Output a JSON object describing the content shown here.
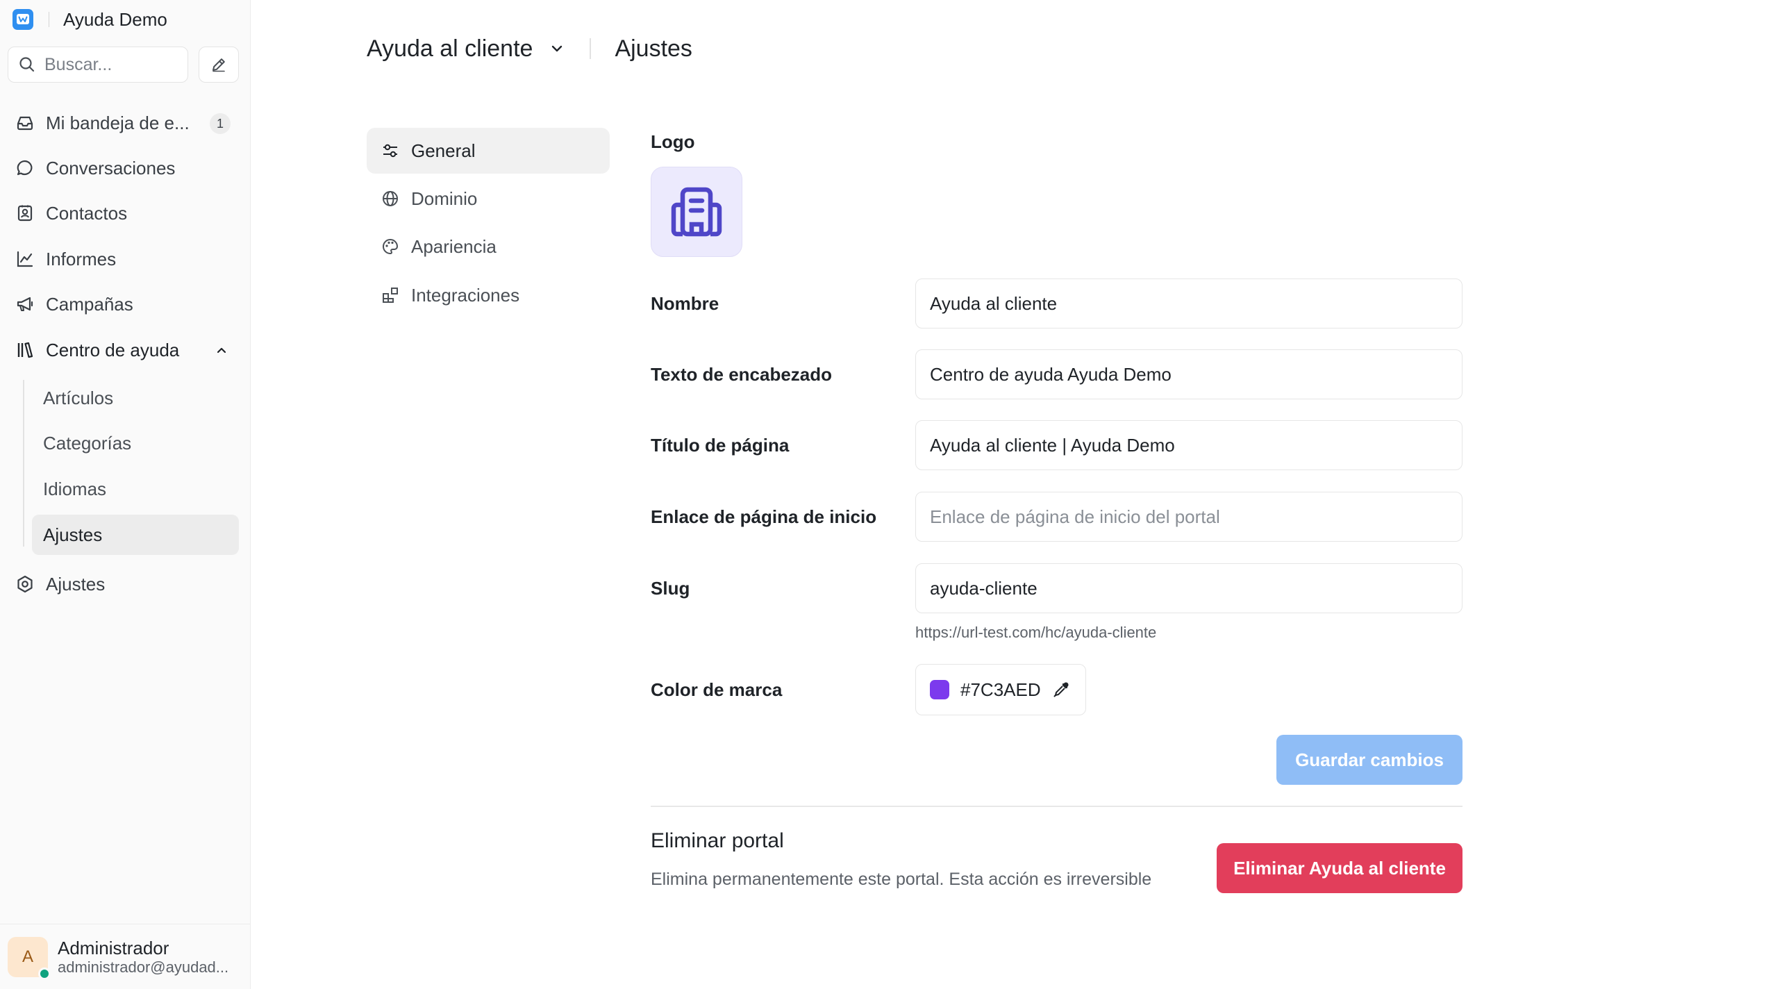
{
  "sidebar": {
    "brand": "Ayuda Demo",
    "search_placeholder": "Buscar...",
    "items": [
      {
        "label": "Mi bandeja de e...",
        "badge": "1",
        "icon": "inbox-icon"
      },
      {
        "label": "Conversaciones",
        "icon": "chat-bubble-icon"
      },
      {
        "label": "Contactos",
        "icon": "contact-card-icon"
      },
      {
        "label": "Informes",
        "icon": "line-chart-icon"
      },
      {
        "label": "Campañas",
        "icon": "megaphone-icon"
      },
      {
        "label": "Centro de ayuda",
        "icon": "library-books-icon",
        "expanded": true
      },
      {
        "label": "Ajustes",
        "icon": "settings-icon"
      }
    ],
    "help_center_subitems": [
      {
        "label": "Artículos"
      },
      {
        "label": "Categorías"
      },
      {
        "label": "Idiomas"
      },
      {
        "label": "Ajustes",
        "active": true
      }
    ],
    "profile": {
      "initial": "A",
      "name": "Administrador",
      "email": "administrador@ayudad...",
      "status_color": "#10a37f"
    }
  },
  "header": {
    "portal": "Ayuda al cliente",
    "page": "Ajustes"
  },
  "subnav": [
    {
      "label": "General",
      "icon": "sliders-icon",
      "active": true
    },
    {
      "label": "Dominio",
      "icon": "globe-icon"
    },
    {
      "label": "Apariencia",
      "icon": "palette-icon"
    },
    {
      "label": "Integraciones",
      "icon": "blocks-icon"
    }
  ],
  "form": {
    "logo_label": "Logo",
    "logo_icon": "building-icon",
    "name_label": "Nombre",
    "name_value": "Ayuda al cliente",
    "header_text_label": "Texto de encabezado",
    "header_text_value": "Centro de ayuda Ayuda Demo",
    "page_title_label": "Título de página",
    "page_title_value": "Ayuda al cliente | Ayuda Demo",
    "homepage_link_label": "Enlace de página de inicio",
    "homepage_link_value": "",
    "homepage_link_placeholder": "Enlace de página de inicio del portal",
    "slug_label": "Slug",
    "slug_value": "ayuda-cliente",
    "slug_url": "https://url-test.com/hc/ayuda-cliente",
    "brand_color_label": "Color de marca",
    "brand_color_value": "#7C3AED",
    "save_label": "Guardar cambios"
  },
  "danger": {
    "title": "Eliminar portal",
    "description": "Elimina permanentemente este portal. Esta acción es irreversible",
    "button_label": "Eliminar Ayuda al cliente"
  },
  "colors": {
    "accent": "#2f8ff0",
    "save_button": "#8fbdf6",
    "danger_button": "#e23e5b",
    "logo_tile": "#eceafd",
    "logo_icon": "#4f46c8"
  }
}
